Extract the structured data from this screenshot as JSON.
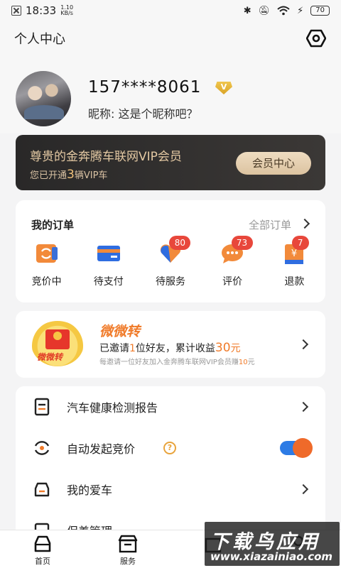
{
  "status_bar": {
    "time": "18:33",
    "speed_value": "1.10",
    "speed_unit": "KB/s",
    "battery": "70"
  },
  "header": {
    "title": "个人中心"
  },
  "profile": {
    "phone": "157****8061",
    "vip_letter": "V",
    "nickname": "昵称: 这是个昵称吧？"
  },
  "vip_card": {
    "title": "尊贵的金奔腾车联网VIP会员",
    "sub_prefix": "您已开通",
    "count": "3",
    "sub_suffix": "辆VIP车",
    "button": "会员中心"
  },
  "orders": {
    "title": "我的订单",
    "all_label": "全部订单",
    "items": [
      {
        "label": "竞价中",
        "icon": "refresh-wallet-icon",
        "badge": ""
      },
      {
        "label": "待支付",
        "icon": "card-icon",
        "badge": ""
      },
      {
        "label": "待服务",
        "icon": "heart-icon",
        "badge": "80"
      },
      {
        "label": "评价",
        "icon": "chat-icon",
        "badge": "73"
      },
      {
        "label": "退款",
        "icon": "refund-icon",
        "badge": "7"
      }
    ],
    "accent": "#f07b2a",
    "badge_color": "#e8473b"
  },
  "invite": {
    "brand": "微微转",
    "logo_text": "微微转",
    "main_prefix": "已邀请",
    "invited_count": "1",
    "main_mid": "位好友，累计收益",
    "earnings": "30",
    "earnings_unit": "元",
    "sub_prefix": "每邀请一位好友加入金奔腾车联网VIP会员赚",
    "sub_amount": "10",
    "sub_unit": "元"
  },
  "menu": {
    "items": [
      {
        "label": "汽车健康检测报告",
        "icon": "report-icon"
      },
      {
        "label": "自动发起竞价",
        "icon": "auto-bid-icon",
        "help": "?",
        "toggle_on": true
      },
      {
        "label": "我的爱车",
        "icon": "car-icon"
      },
      {
        "label": "保养管理",
        "icon": "maintenance-icon"
      }
    ]
  },
  "bottom_nav": {
    "items": [
      {
        "label": "首页",
        "icon": "car-home-icon"
      },
      {
        "label": "服务",
        "icon": "service-icon"
      },
      {
        "label": "",
        "icon": "shop-icon"
      },
      {
        "label": "",
        "icon": "profile-icon"
      }
    ]
  },
  "watermark": {
    "main": "下载鸟应用",
    "url": "www.xiazainiao.com"
  },
  "colors": {
    "vip_gold": "#e4c9a3",
    "toggle_blue": "#2d7be5",
    "toggle_knob": "#ef6a2a"
  }
}
